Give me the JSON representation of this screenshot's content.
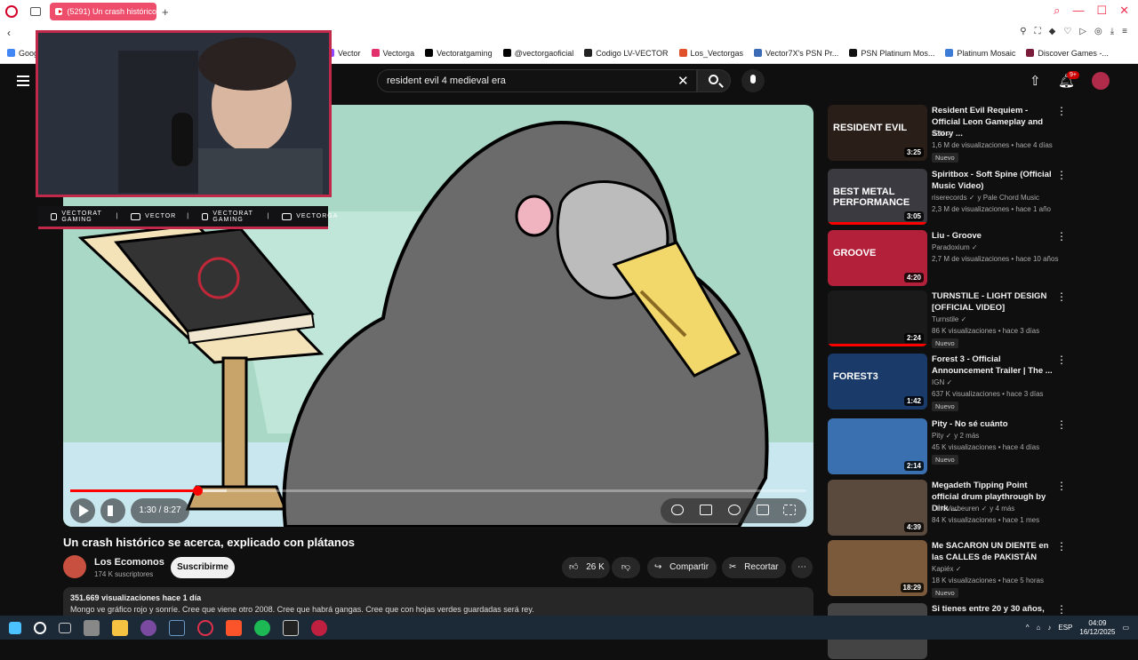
{
  "browser": {
    "tab_title": "(5291) Un crash histórico",
    "bookmarks": [
      {
        "label": "Goog",
        "color": "#4285f4"
      },
      {
        "label": "Vector",
        "color": "#9146ff"
      },
      {
        "label": "Vectorga",
        "color": "#e1306c"
      },
      {
        "label": "Vectoratgaming",
        "color": "#000000"
      },
      {
        "label": "@vectorgaoficial",
        "color": "#000000"
      },
      {
        "label": "Codigo LV-VECTOR",
        "color": "#222222"
      },
      {
        "label": "Los_Vectorgas",
        "color": "#e0502a"
      },
      {
        "label": "Vector7X's PSN Pr...",
        "color": "#3b6bb5"
      },
      {
        "label": "PSN Platinum Mos...",
        "color": "#111111"
      },
      {
        "label": "Platinum Mosaic",
        "color": "#3c7bd6"
      },
      {
        "label": "Discover Games -...",
        "color": "#7a1b3a"
      }
    ]
  },
  "header": {
    "search_value": "resident evil 4 medieval era",
    "notif_badge": "9+"
  },
  "overlay": {
    "socials": [
      "VECTORAT GAMING",
      "VECTOR",
      "VECTORAT GAMING",
      "VECTORGA"
    ]
  },
  "player": {
    "time": "1:30 / 8:27",
    "progress_fraction": 0.18
  },
  "video": {
    "title": "Un crash histórico se acerca, explicado con plátanos",
    "channel": "Los Ecomonos",
    "subscribers": "174 K suscriptores",
    "subscribe_label": "Suscribirme",
    "likes": "26 K",
    "share_label": "Compartir",
    "clip_label": "Recortar",
    "views_line": "351.669 visualizaciones  hace 1 día",
    "description": "Mongo ve gráfico rojo y sonríe. Cree que viene otro 2008. Cree que habrá gangas. Cree que con hojas verdes guardadas será rey."
  },
  "sidebar": [
    {
      "title": "Resident Evil Requiem - Official Leon Gameplay and Story ...",
      "channel": "IGN",
      "meta": "1,6 M de visualizaciones • hace 4 días",
      "badge": "Nuevo",
      "duration": "3:25",
      "thumb_text": "RESIDENT EVIL",
      "thumb_bg": "#2a1e18"
    },
    {
      "title": "Spiritbox - Soft Spine (Official Music Video)",
      "channel": "riserecords",
      "channel_extra": "y Pale Chord Music",
      "meta": "2,3 M de visualizaciones • hace 1 año",
      "badge": "",
      "duration": "3:05",
      "thumb_text": "BEST METAL PERFORMANCE",
      "thumb_bg": "#3a3a40"
    },
    {
      "title": "Liu - Groove",
      "channel": "Paradoxium",
      "meta": "2,7 M de visualizaciones • hace 10 años",
      "badge": "",
      "duration": "4:20",
      "thumb_text": "GROOVE",
      "thumb_bg": "#b3203a"
    },
    {
      "title": "TURNSTILE - LIGHT DESIGN [OFFICIAL VIDEO]",
      "channel": "Turnstile",
      "meta": "86 K visualizaciones • hace 3 días",
      "badge": "Nuevo",
      "duration": "2:24",
      "thumb_text": "",
      "thumb_bg": "#1a1a1a"
    },
    {
      "title": "Forest 3 - Official Announcement Trailer | The ...",
      "channel": "IGN",
      "meta": "637 K visualizaciones • hace 3 días",
      "badge": "Nuevo",
      "duration": "1:42",
      "thumb_text": "FOREST3",
      "thumb_bg": "#1a3b6a"
    },
    {
      "title": "Pity - No sé cuánto",
      "channel": "Pity",
      "channel_extra": "y 2 más",
      "meta": "45 K visualizaciones • hace 4 días",
      "badge": "Nuevo",
      "duration": "2:14",
      "thumb_text": "",
      "thumb_bg": "#3a6fb0"
    },
    {
      "title": "Megadeth Tipping Point official drum playthrough by Dirk ...",
      "channel": "Dirk Verbeuren",
      "channel_extra": "y 4 más",
      "meta": "84 K visualizaciones • hace 1 mes",
      "badge": "",
      "duration": "4:39",
      "thumb_text": "",
      "thumb_bg": "#5a4a3e"
    },
    {
      "title": "Me SACARON UN DIENTE en las CALLES de PAKISTÁN",
      "channel": "Kapiéx",
      "meta": "18 K visualizaciones • hace 5 horas",
      "badge": "Nuevo",
      "duration": "18:29",
      "thumb_text": "",
      "thumb_bg": "#7a5a3a"
    },
    {
      "title": "Si tienes entre 20 y 30 años,",
      "channel": "",
      "meta": "",
      "badge": "",
      "duration": "",
      "thumb_text": "",
      "thumb_bg": "#444"
    }
  ],
  "taskbar": {
    "lang": "ESP",
    "time": "04:09",
    "date": "16/12/2025"
  }
}
